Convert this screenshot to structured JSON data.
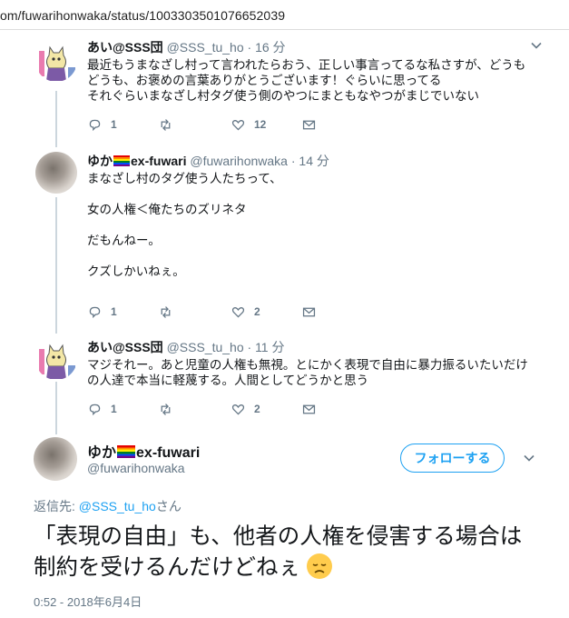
{
  "browser": {
    "url": "om/fuwarihonwaka/status/1003303501076652039"
  },
  "tweets": [
    {
      "name": "あい@SSS団",
      "handle": "@SSS_tu_ho",
      "time": "16 分",
      "text": "最近もうまなざし村って言われたらおう、正しい事言ってるな私さすが、どうもどうも、お褒めの言葉ありがとうございます！ぐらいに思ってる\nそれぐらいまなざし村タグ使う側のやつにまともなやつがまじでいない",
      "reply_count": "1",
      "retweet_count": "",
      "like_count": "12"
    },
    {
      "name": "ゆか",
      "name_suffix": "ex-fuwari",
      "handle": "@fuwarihonwaka",
      "time": "14 分",
      "text": "まなざし村のタグ使う人たちって、\n\n女の人権＜俺たちのズリネタ\n\nだもんねー。\n\nクズしかいねぇ。",
      "reply_count": "1",
      "retweet_count": "",
      "like_count": "2"
    },
    {
      "name": "あい@SSS団",
      "handle": "@SSS_tu_ho",
      "time": "11 分",
      "text": "マジそれー。あと児童の人権も無視。とにかく表現で自由に暴力振るいたいだけの人達で本当に軽蔑する。人間としてどうかと思う",
      "reply_count": "1",
      "retweet_count": "",
      "like_count": "2"
    }
  ],
  "main_tweet": {
    "name": "ゆか",
    "name_suffix": "ex-fuwari",
    "handle": "@fuwarihonwaka",
    "follow_label": "フォローする",
    "reply_to_prefix": "返信先: ",
    "reply_to_mention": "@SSS_tu_ho",
    "reply_to_suffix": "さん",
    "text": "「表現の自由」も、他者の人権を侵害する場合は制約を受けるんだけどねぇ",
    "timestamp": "0:52 - 2018年6月4日"
  },
  "icons": {
    "reply": "reply-icon",
    "retweet": "retweet-icon",
    "like": "heart-icon",
    "dm": "envelope-icon",
    "caret": "chevron-down-icon",
    "flag": "rainbow-flag-icon",
    "emoji": "disappointed-face-emoji"
  },
  "colors": {
    "accent": "#1da1f2",
    "secondary_text": "#657786",
    "thread_line": "#ccd6dd"
  }
}
